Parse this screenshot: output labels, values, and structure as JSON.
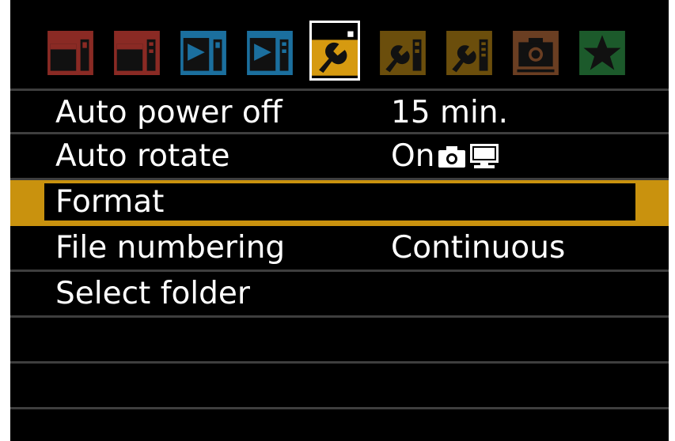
{
  "tabs": [
    {
      "name": "shooting-1",
      "color": "#8a2a24",
      "icon": "camera-1-icon"
    },
    {
      "name": "shooting-2",
      "color": "#8a2a24",
      "icon": "camera-2-icon"
    },
    {
      "name": "playback-1",
      "color": "#1b6f9e",
      "icon": "playback-1-icon"
    },
    {
      "name": "playback-2",
      "color": "#1b6f9e",
      "icon": "playback-2-icon"
    },
    {
      "name": "setup-1",
      "color": "#d69a10",
      "icon": "wrench-1-icon",
      "active": true
    },
    {
      "name": "setup-2",
      "color": "#6b4e0c",
      "icon": "wrench-2-icon"
    },
    {
      "name": "setup-3",
      "color": "#6b4e0c",
      "icon": "wrench-3-icon"
    },
    {
      "name": "live-view",
      "color": "#6a3e22",
      "icon": "live-view-camera-icon"
    },
    {
      "name": "my-menu",
      "color": "#1c5a2b",
      "icon": "star-icon"
    }
  ],
  "menu": {
    "items": [
      {
        "label": "Auto power off",
        "value": "15 min."
      },
      {
        "label": "Auto rotate",
        "value": "On",
        "value_icons": [
          "camera-icon",
          "monitor-icon"
        ]
      },
      {
        "label": "Format",
        "value": "",
        "selected": true
      },
      {
        "label": "File numbering",
        "value": "Continuous"
      },
      {
        "label": "Select folder",
        "value": ""
      },
      {
        "label": "",
        "value": ""
      },
      {
        "label": "",
        "value": ""
      }
    ]
  },
  "colors": {
    "highlight": "#c9920e",
    "separator": "#3e3e3e",
    "background": "#000000",
    "text": "#ffffff"
  }
}
